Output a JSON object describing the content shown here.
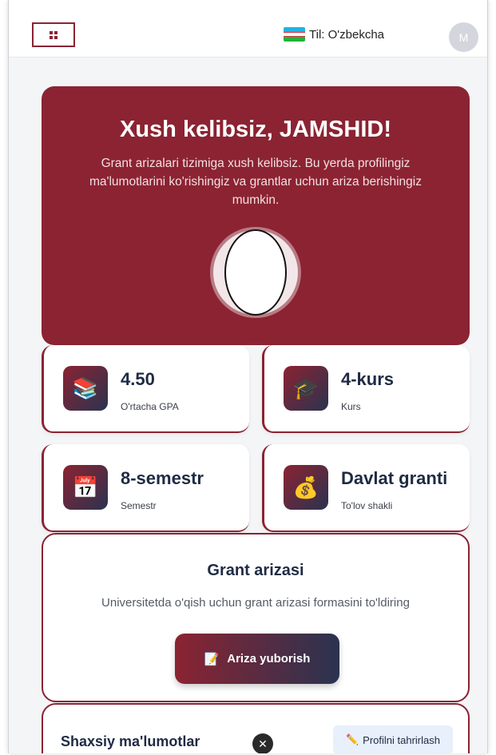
{
  "topbar": {
    "language_label": "Til: O'zbekcha",
    "avatar_letter": "M"
  },
  "hero": {
    "title": "Xush kelibsiz, JAMSHID!",
    "subtitle": "Grant arizalari tizimiga xush kelibsiz. Bu yerda profilingiz ma'lumotlarini ko'rishingiz va grantlar uchun ariza berishingiz mumkin."
  },
  "stats": [
    {
      "icon": "books-icon",
      "glyph": "📚",
      "value": "4.50",
      "label": "O'rtacha GPA"
    },
    {
      "icon": "graduation-cap-icon",
      "glyph": "🎓",
      "value": "4-kurs",
      "label": "Kurs"
    },
    {
      "icon": "calendar-icon",
      "glyph": "📅",
      "value": "8-semestr",
      "label": "Semestr"
    },
    {
      "icon": "money-bag-icon",
      "glyph": "💰",
      "value": "Davlat granti",
      "label": "To'lov shakli"
    }
  ],
  "grant": {
    "title": "Grant arizasi",
    "description": "Universitetda o'qish uchun grant arizasi formasini to'ldiring",
    "button_icon": "📝",
    "button_label": "Ariza yuborish"
  },
  "personal": {
    "title": "Shaxsiy ma'lumotlar",
    "close_glyph": "✕",
    "edit_icon": "✏️",
    "edit_label": "Profilni tahrirlash"
  },
  "colors": {
    "brand": "#8b2332",
    "navy": "#1f2b44"
  }
}
